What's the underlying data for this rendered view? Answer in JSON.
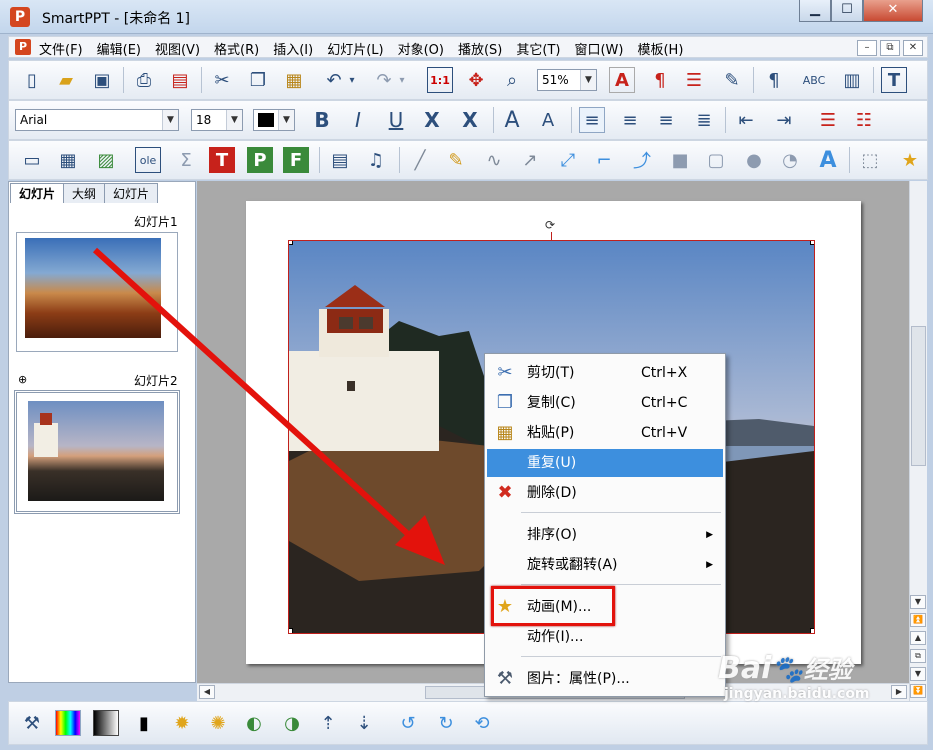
{
  "window": {
    "title": "SmartPPT    - [未命名 1]",
    "logo": "P",
    "min": "▁",
    "max": "☐",
    "close": "✕"
  },
  "menu": {
    "items": [
      "文件(F)",
      "编辑(E)",
      "视图(V)",
      "格式(R)",
      "插入(I)",
      "幻灯片(L)",
      "对象(O)",
      "播放(S)",
      "其它(T)",
      "窗口(W)",
      "模板(H)"
    ],
    "mdi_min": "–",
    "mdi_restore": "⧉",
    "mdi_close": "✕"
  },
  "toolbar1": {
    "zoom": "51%",
    "icons": [
      "new-icon",
      "open-icon",
      "save-icon",
      "print-icon",
      "pdf-icon",
      "cut-icon",
      "copy-icon",
      "paste-icon",
      "undo-icon",
      "redo-icon",
      "actual-size-icon",
      "pan-icon",
      "zoom-icon",
      "font-color-icon",
      "paragraph-icon",
      "list-icon",
      "format-painter-icon",
      "pilcrow-icon",
      "spellcheck-icon",
      "chart-icon",
      "textbox-icon"
    ]
  },
  "toolbar2": {
    "font": "Arial",
    "size": "18",
    "bold": "B",
    "italic": "I",
    "underline": "U",
    "strike": "X",
    "shadow": "X",
    "grow": "A",
    "shrink": "A"
  },
  "toolbar3": {
    "icons": [
      "frame-icon",
      "table-icon",
      "picture-icon",
      "ole-icon",
      "formula-icon",
      "text-object-icon",
      "paragraph-object-icon",
      "field-icon",
      "video-icon",
      "audio-icon",
      "line-icon",
      "pen-icon",
      "curve-icon",
      "arrow-icon",
      "connector1-icon",
      "connector2-icon",
      "connector3-icon",
      "rectangle-icon",
      "rounded-rect-icon",
      "ellipse-icon",
      "callout-icon",
      "wordart-icon",
      "group-icon",
      "star-icon"
    ]
  },
  "panel": {
    "tabs": [
      "幻灯片",
      "大纲",
      "幻灯片"
    ],
    "slides": [
      {
        "label": "幻灯片1"
      },
      {
        "label": "幻灯片2"
      }
    ]
  },
  "context_menu": {
    "items": [
      {
        "label": "剪切(T)",
        "shortcut": "Ctrl+X",
        "icon": "scissors-icon"
      },
      {
        "label": "复制(C)",
        "shortcut": "Ctrl+C",
        "icon": "copy-icon"
      },
      {
        "label": "粘贴(P)",
        "shortcut": "Ctrl+V",
        "icon": "paste-icon"
      },
      {
        "label": "重复(U)",
        "shortcut": "",
        "icon": ""
      },
      {
        "label": "删除(D)",
        "shortcut": "",
        "icon": "delete-icon"
      },
      {
        "label": "排序(O)",
        "shortcut": "",
        "icon": ""
      },
      {
        "label": "旋转或翻转(A)",
        "shortcut": "",
        "icon": ""
      },
      {
        "label": "动画(M)...",
        "shortcut": "",
        "icon": "star-icon"
      },
      {
        "label": "动作(I)...",
        "shortcut": "",
        "icon": ""
      },
      {
        "label": "图片：属性(P)...",
        "shortcut": "",
        "icon": "wrench-icon"
      }
    ]
  },
  "watermark": {
    "brand": "Bai",
    "brand2": "经验",
    "url": "jingyan.baidu.com"
  },
  "colors": {
    "highlight": "#3d8fde",
    "annotation_red": "#e3120c"
  }
}
